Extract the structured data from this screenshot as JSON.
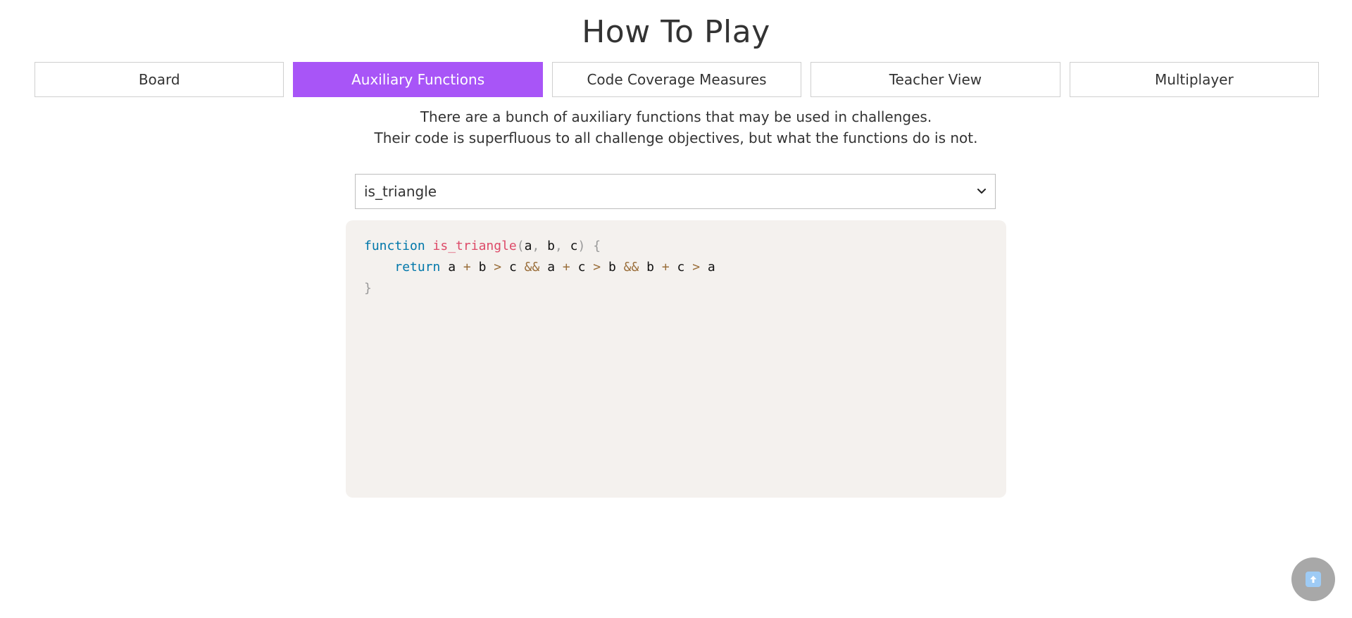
{
  "page": {
    "title": "How To Play"
  },
  "tabs": [
    {
      "label": "Board",
      "active": false
    },
    {
      "label": "Auxiliary Functions",
      "active": true
    },
    {
      "label": "Code Coverage Measures",
      "active": false
    },
    {
      "label": "Teacher View",
      "active": false
    },
    {
      "label": "Multiplayer",
      "active": false
    }
  ],
  "intro": {
    "line1": "There are a bunch of auxiliary functions that may be used in challenges.",
    "line2": "Their code is superfluous to all challenge objectives, but what the functions do is not."
  },
  "function_select": {
    "selected": "is_triangle",
    "icon": "chevron-down-icon"
  },
  "code": {
    "kw_function": "function",
    "fn_name": "is_triangle",
    "paren_open": "(",
    "param_a": "a",
    "comma": ",",
    "param_b": "b",
    "param_c": "c",
    "paren_close": ")",
    "brace_open": "{",
    "indent": "    ",
    "kw_return": "return",
    "plus": "+",
    "gt": ">",
    "and": "&&",
    "brace_close": "}"
  },
  "scroll_top_button": {
    "icon": "arrow-up-icon"
  },
  "colors": {
    "accent": "#a855f7",
    "code_bg": "#f4f1ee",
    "keyword": "#0077aa",
    "function_name": "#dd4a68",
    "operator": "#9a6e3a",
    "punctuation": "#999999"
  }
}
